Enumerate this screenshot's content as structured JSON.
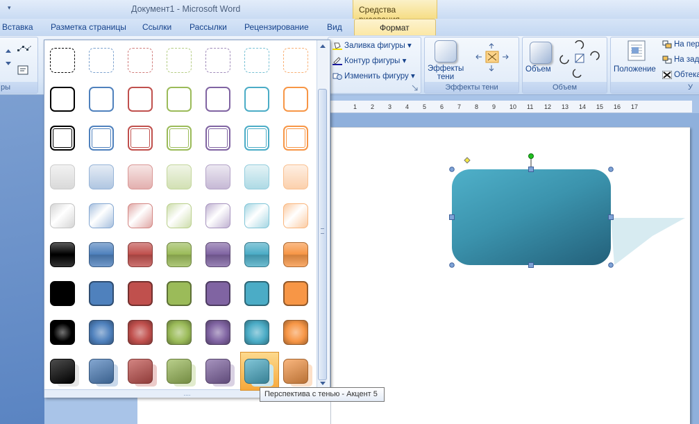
{
  "window": {
    "title": "Документ1 - Microsoft Word",
    "qat_glyph": "▾"
  },
  "contextual_tab_group": "Средства рисования",
  "tabs": [
    "Вставка",
    "Разметка страницы",
    "Ссылки",
    "Рассылки",
    "Рецензирование",
    "Вид"
  ],
  "active_tab": "Формат",
  "ribbon": {
    "left_group_label": "ры",
    "shape_styles": {
      "fill": "Заливка фигуры",
      "outline": "Контур фигуры",
      "change": "Изменить фигуру"
    },
    "shadow_group": {
      "button_label": "Эффекты\nтени",
      "label": "Эффекты тени"
    },
    "volume_group": {
      "button_label": "Объем",
      "label": "Объем"
    },
    "arrange_group": {
      "position": "Положение",
      "front": "На пер",
      "back": "На зад",
      "wrap": "Обтека",
      "label": "У"
    }
  },
  "ruler": [
    "1",
    "2",
    "3",
    "4",
    "5",
    "6",
    "7",
    "8",
    "9",
    "10",
    "11",
    "12",
    "13",
    "14",
    "15",
    "16",
    "17"
  ],
  "gallery": {
    "colors": [
      "#000000",
      "#4f81bd",
      "#c0504d",
      "#9bbb59",
      "#8064a2",
      "#4bacc6",
      "#f79646"
    ],
    "row_styles": [
      "dashed",
      "outline",
      "double-outline",
      "light-gradient",
      "light-diagonal",
      "glossy",
      "solid",
      "radial-glow",
      "perspective-shadow"
    ],
    "selected": {
      "row": 8,
      "col": 5
    },
    "grip": "....",
    "tooltip": "Перспектива с тенью - Акцент 5"
  },
  "document": {
    "shape": {
      "type": "rounded-rectangle",
      "fill": "#3b93ad",
      "style": "Перспектива с тенью - Акцент 5"
    }
  }
}
